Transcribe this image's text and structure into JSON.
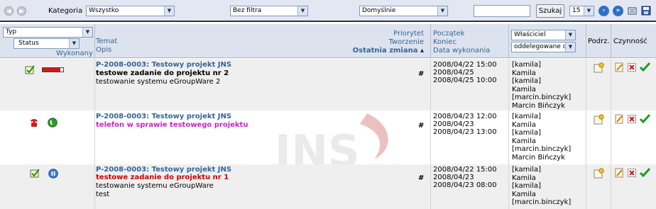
{
  "toolbar": {
    "category_label": "Kategoria",
    "category_value": "Wszystko",
    "filter_value": "Bez filtra",
    "sort_value": "Domyślnie",
    "search_value": "",
    "search_button": "Szukaj",
    "page_size": "15"
  },
  "header": {
    "type_select": "Typ",
    "status_select": "Status",
    "completed": "Wykonany",
    "subject": "Temat",
    "description": "Opis",
    "priority": "Priorytet",
    "created": "Tworzenie",
    "last_change": "Ostatnia zmiana",
    "start": "Początek",
    "end": "Koniec",
    "completion_date": "Data wykonania",
    "owner_select": "Właściciel",
    "delegated_select": "oddelegowane d",
    "sub": "Podrz.",
    "actions": "Czynność"
  },
  "rows": [
    {
      "project": "P-2008-0003: Testowy projekt JNS",
      "title": "testowe zadanie do projektu nr 2",
      "title_color": "#000000",
      "desc": "testowanie systemu eGroupWare 2",
      "priority_mark": "#",
      "dates": [
        "2008/04/22 15:00",
        "2008/04/25",
        "2008/04/25 10:00"
      ],
      "users": [
        "[kamila]",
        "Kamila",
        "[kamila]",
        "Kamila",
        "[marcin.binczyk]",
        "Marcin Bińczyk"
      ],
      "progress": 0.85
    },
    {
      "project": "P-2008-0003: Testowy projekt JNS",
      "title": "telefon w sprawie testowego projektu",
      "title_color": "#cc22cc",
      "desc": "",
      "priority_mark": "#",
      "dates": [
        "2008/04/23 12:00",
        "2008/04/23",
        "2008/04/23 13:00"
      ],
      "users": [
        "[kamila]",
        "Kamila",
        "[kamila]",
        "Kamila",
        "[marcin.binczyk]",
        "Marcin Bińczyk"
      ]
    },
    {
      "project": "P-2008-0003: Testowy projekt JNS",
      "title": "testowe zadanie do projektu nr 1",
      "title_color": "#cc0000",
      "desc_lines": [
        "testowanie systemu eGroupWare",
        "test"
      ],
      "priority_mark": "#",
      "dates": [
        "2008/04/22 15:00",
        "2008/04/23",
        "2008/04/23 08:00"
      ],
      "users": [
        "[kamila]",
        "Kamila",
        "[kamila]",
        "Kamila",
        "[marcin.binczyk]"
      ]
    }
  ],
  "watermark": {
    "logo": "JNS",
    "url": "www.jns.pl"
  },
  "colors": {
    "toolbar_bg": "#e2e7f2",
    "header_bg": "#dde3ee",
    "link": "#336699"
  }
}
